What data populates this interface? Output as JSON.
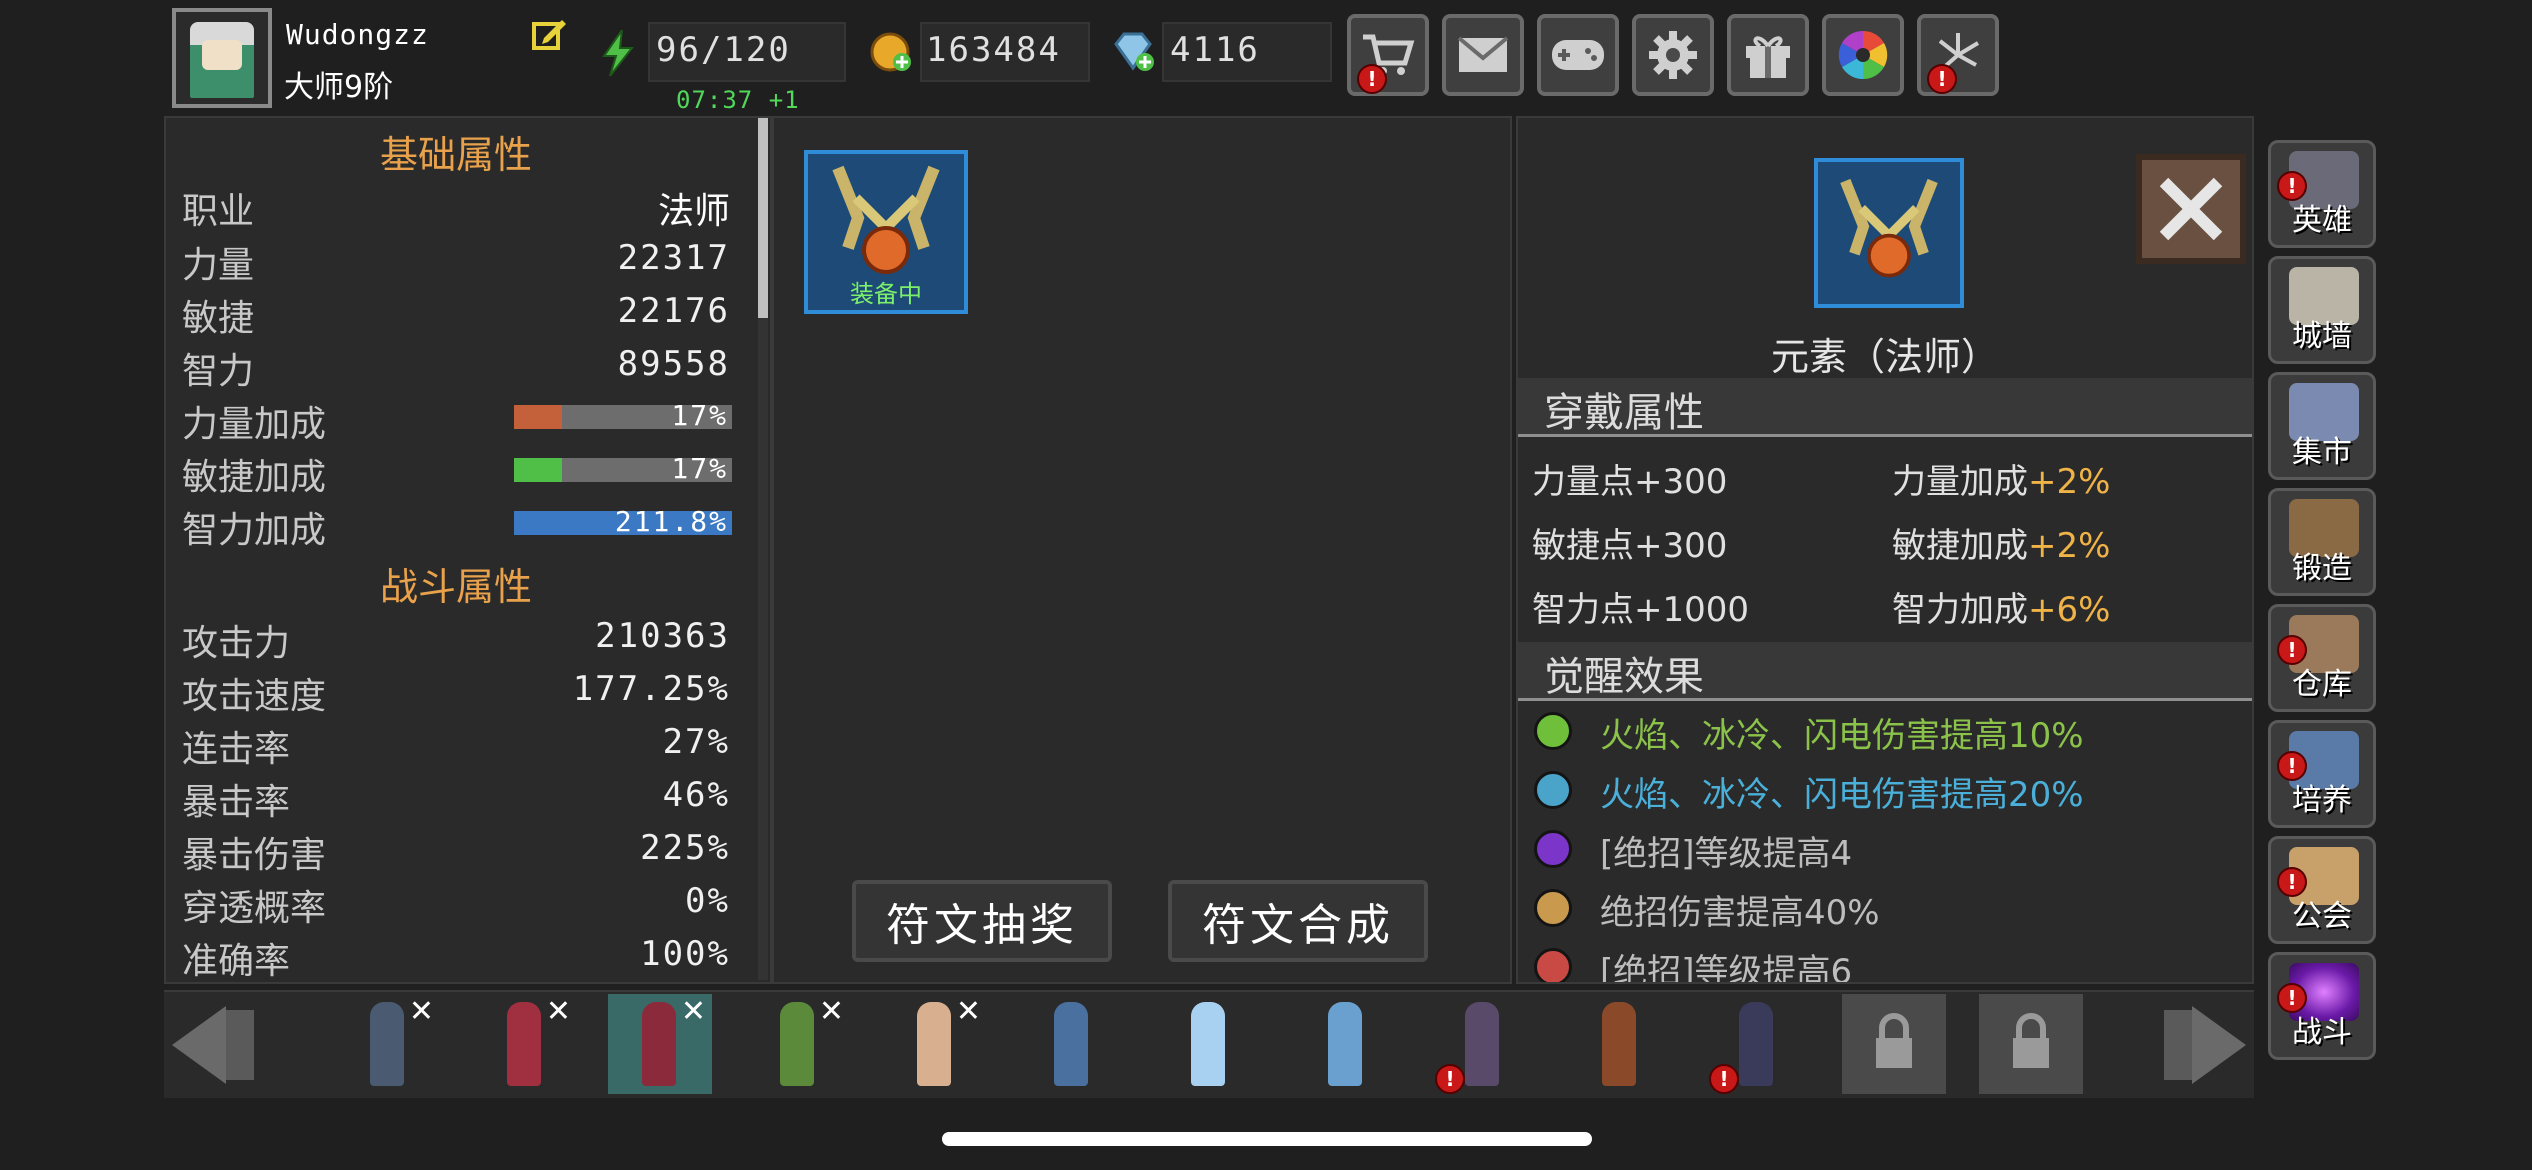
{
  "player": {
    "name": "Wudongzz",
    "rank": "大师9阶"
  },
  "resources": {
    "energy": "96/120",
    "energy_timer": "07:37 +1",
    "gold": "163484",
    "gems": "4116"
  },
  "top_icons": [
    {
      "name": "shop-cart-icon",
      "alert": "!"
    },
    {
      "name": "mail-icon",
      "alert": ""
    },
    {
      "name": "gamepad-icon",
      "alert": ""
    },
    {
      "name": "settings-gear-icon",
      "alert": ""
    },
    {
      "name": "gift-icon",
      "alert": ""
    },
    {
      "name": "color-wheel-icon",
      "alert": ""
    },
    {
      "name": "fireworks-icon",
      "alert": "!"
    }
  ],
  "stats": {
    "basic_title": "基础属性",
    "class_label": "职业",
    "class_value": "法师",
    "str_label": "力量",
    "str_value": "22317",
    "agi_label": "敏捷",
    "agi_value": "22176",
    "int_label": "智力",
    "int_value": "89558",
    "str_bonus_label": "力量加成",
    "str_bonus": "17%",
    "str_bonus_fill": 0.22,
    "agi_bonus_label": "敏捷加成",
    "agi_bonus": "17%",
    "agi_bonus_fill": 0.22,
    "int_bonus_label": "智力加成",
    "int_bonus": "211.8%",
    "int_bonus_fill": 1.0,
    "combat_title": "战斗属性",
    "atk_label": "攻击力",
    "atk_value": "210363",
    "aspd_label": "攻击速度",
    "aspd_value": "177.25%",
    "combo_label": "连击率",
    "combo_value": "27%",
    "crit_label": "暴击率",
    "crit_value": "46%",
    "critdmg_label": "暴击伤害",
    "critdmg_value": "225%",
    "pierce_label": "穿透概率",
    "pierce_value": "0%",
    "acc_label": "准确率",
    "acc_value": "100%"
  },
  "inventory": {
    "equipped_label": "装备中",
    "rune_draw": "符文抽奖",
    "rune_merge": "符文合成"
  },
  "detail": {
    "item_name": "元素（法师）",
    "wear_title": "穿戴属性",
    "wear_attrs": [
      {
        "label": "力量点",
        "value": "+300"
      },
      {
        "label": "力量加成",
        "value": "+2%"
      },
      {
        "label": "敏捷点",
        "value": "+300"
      },
      {
        "label": "敏捷加成",
        "value": "+2%"
      },
      {
        "label": "智力点",
        "value": "+1000"
      },
      {
        "label": "智力加成",
        "value": "+6%"
      }
    ],
    "awaken_title": "觉醒效果",
    "effects": [
      {
        "text": "火焰、冰冷、闪电伤害提高10%",
        "color": "#8bc34a",
        "dot": "#6fbf3b"
      },
      {
        "text": "火焰、冰冷、闪电伤害提高20%",
        "color": "#4ab0d9",
        "dot": "#4aa3c8"
      },
      {
        "text": "[绝招]等级提高4",
        "color": "#bdbdbd",
        "dot": "#7b35c9"
      },
      {
        "text": "绝招伤害提高40%",
        "color": "#bdbdbd",
        "dot": "#c99a4e"
      },
      {
        "text": "[绝招]等级提高6",
        "color": "#bdbdbd",
        "dot": "#c94a45"
      }
    ]
  },
  "side_nav": [
    {
      "label": "英雄",
      "alert": "!"
    },
    {
      "label": "城墙",
      "alert": ""
    },
    {
      "label": "集市",
      "alert": ""
    },
    {
      "label": "锻造",
      "alert": ""
    },
    {
      "label": "仓库",
      "alert": "!"
    },
    {
      "label": "培养",
      "alert": "!"
    },
    {
      "label": "公会",
      "alert": "!"
    },
    {
      "label": "战斗",
      "alert": "!"
    }
  ],
  "heroes": [
    {
      "x": "✕",
      "alert": ""
    },
    {
      "x": "✕",
      "alert": ""
    },
    {
      "x": "✕",
      "alert": ""
    },
    {
      "x": "✕",
      "alert": ""
    },
    {
      "x": "✕",
      "alert": ""
    },
    {
      "x": "",
      "alert": ""
    },
    {
      "x": "",
      "alert": ""
    },
    {
      "x": "",
      "alert": ""
    },
    {
      "x": "",
      "alert": "!"
    },
    {
      "x": "",
      "alert": ""
    },
    {
      "x": "",
      "alert": "!"
    }
  ],
  "colors": {
    "accent_orange": "#e9a24b",
    "str_bar": "#c4603a",
    "agi_bar": "#4fbf48",
    "int_bar": "#3b79c4",
    "timer_green": "#51d85a"
  }
}
